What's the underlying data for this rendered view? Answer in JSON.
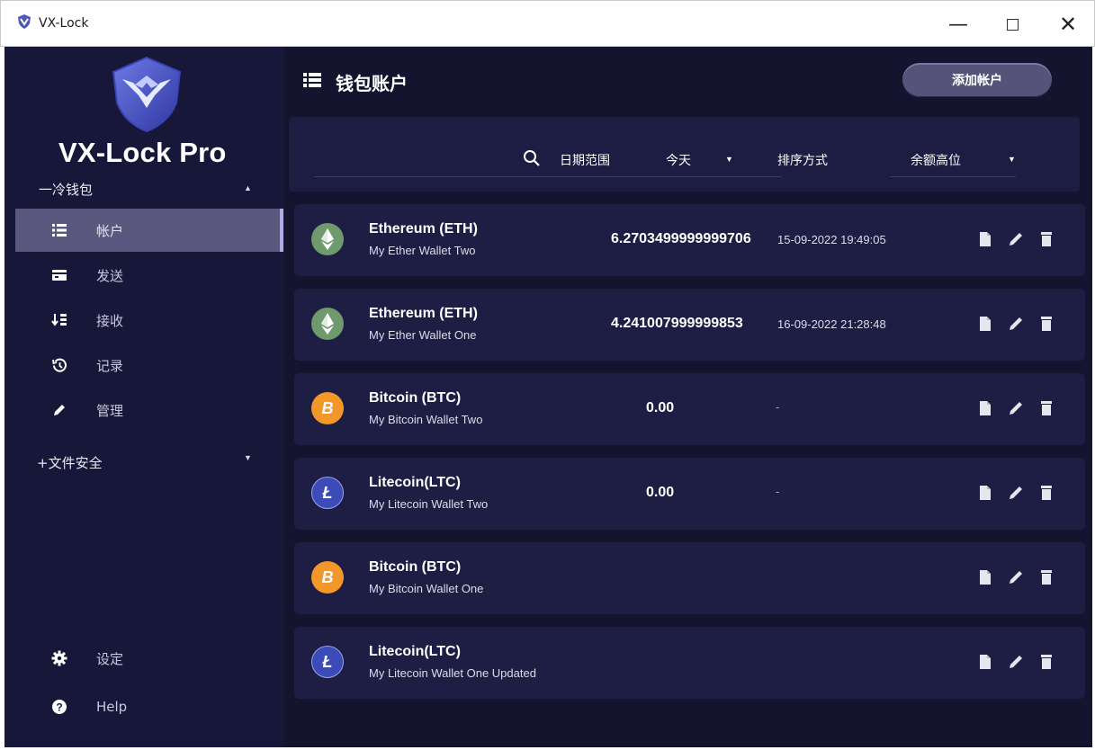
{
  "window": {
    "title": "VX-Lock",
    "minimize": "—",
    "close": "✕"
  },
  "sidebar": {
    "brand": "VX-Lock Pro",
    "sections": [
      {
        "label": "一冷钱包",
        "caret": "▲"
      },
      {
        "label": "+文件安全",
        "caret": "▼"
      }
    ],
    "items": [
      {
        "label": "帐户",
        "icon": "list-icon",
        "active": true
      },
      {
        "label": "发送",
        "icon": "wallet-icon",
        "active": false
      },
      {
        "label": "接收",
        "icon": "receive-icon",
        "active": false
      },
      {
        "label": "记录",
        "icon": "history-icon",
        "active": false
      },
      {
        "label": "管理",
        "icon": "edit-icon",
        "active": false
      }
    ],
    "bottom": [
      {
        "label": "设定",
        "icon": "gear-icon"
      },
      {
        "label": "Help",
        "icon": "help-icon"
      }
    ]
  },
  "main": {
    "title": "钱包账户",
    "add_button": "添加帐户",
    "filter": {
      "date_label": "日期范围",
      "date_value": "今天",
      "sort_label": "排序方式",
      "sort_value": "余额高位"
    },
    "accounts": [
      {
        "coin": "eth",
        "name": "Ethereum (ETH)",
        "wallet": "My Ether Wallet Two",
        "balance": "6.2703499999999706",
        "date": "15-09-2022 19:49:05"
      },
      {
        "coin": "eth",
        "name": "Ethereum (ETH)",
        "wallet": "My Ether Wallet One",
        "balance": "4.241007999999853",
        "date": "16-09-2022 21:28:48"
      },
      {
        "coin": "btc",
        "name": "Bitcoin (BTC)",
        "wallet": "My Bitcoin Wallet Two",
        "balance": "0.00",
        "date": "-"
      },
      {
        "coin": "ltc",
        "name": "Litecoin(LTC)",
        "wallet": "My Litecoin Wallet Two",
        "balance": "0.00",
        "date": "-"
      },
      {
        "coin": "btc",
        "name": "Bitcoin (BTC)",
        "wallet": "My Bitcoin Wallet One",
        "balance": "",
        "date": ""
      },
      {
        "coin": "ltc",
        "name": "Litecoin(LTC)",
        "wallet": "My Litecoin Wallet One Updated",
        "balance": "",
        "date": ""
      }
    ]
  },
  "colors": {
    "window_bg": "#14142e",
    "sidebar_bg": "#17173a",
    "card_bg": "#1e1e45",
    "active_item": "#5a587f",
    "eth": "#6e9a6e",
    "btc": "#f2982a",
    "ltc": "#3b4bb8"
  }
}
